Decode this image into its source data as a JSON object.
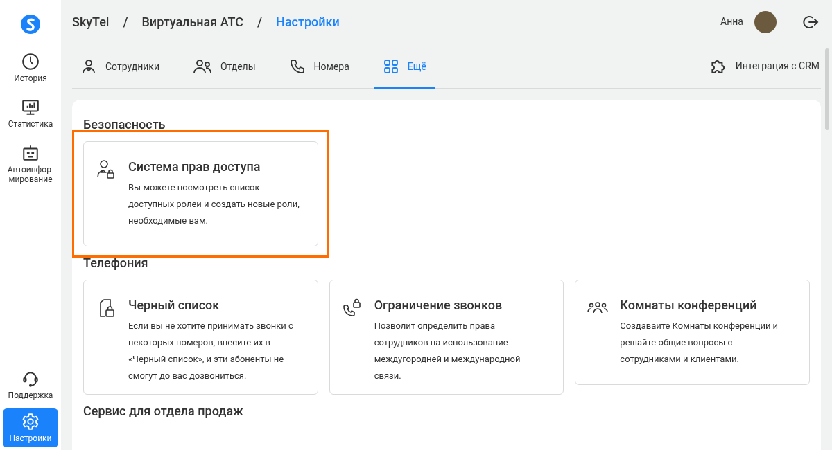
{
  "sidebar": {
    "top_items": [
      {
        "label": "История",
        "selected": false
      },
      {
        "label": "Статистика",
        "selected": false
      },
      {
        "label": "Автоинфор-мирование",
        "selected": false
      }
    ],
    "bottom_items": [
      {
        "label": "Поддержка",
        "selected": false
      },
      {
        "label": "Настройки",
        "selected": true
      }
    ]
  },
  "breadcrumbs": [
    {
      "label": "SkyTel",
      "current": false
    },
    {
      "label": "Виртуальная АТС",
      "current": false
    },
    {
      "label": "Настройки",
      "current": true
    }
  ],
  "breadcrumb_separator": "/",
  "user": {
    "name": "Анна"
  },
  "tabs": [
    {
      "label": "Сотрудники",
      "selected": false
    },
    {
      "label": "Отделы",
      "selected": false
    },
    {
      "label": "Номера",
      "selected": false
    },
    {
      "label": "Ещё",
      "selected": true
    }
  ],
  "integration_link": "Интеграция с CRM",
  "sections": [
    {
      "title": "Безопасность",
      "cards": [
        {
          "title": "Система прав доступа",
          "description": "Вы можете посмотреть список доступных ролей и создать новые роли, необходимые вам.",
          "highlighted": true
        }
      ]
    },
    {
      "title": "Телефония",
      "cards": [
        {
          "title": "Черный список",
          "description": "Если вы не хотите принимать звонки с некоторых номеров, внесите их в «Черный список», и эти абоненты не смогут до вас дозвониться.",
          "highlighted": false
        },
        {
          "title": "Ограничение звонков",
          "description": "Позволит определить права сотрудников на использование междугородней и международной связи.",
          "highlighted": false
        },
        {
          "title": "Комнаты конференций",
          "description": "Создавайте Комнаты конференций и решайте общие вопросы с сотрудниками и клиентами.",
          "highlighted": false
        }
      ]
    },
    {
      "title": "Сервис для отдела продаж"
    }
  ]
}
